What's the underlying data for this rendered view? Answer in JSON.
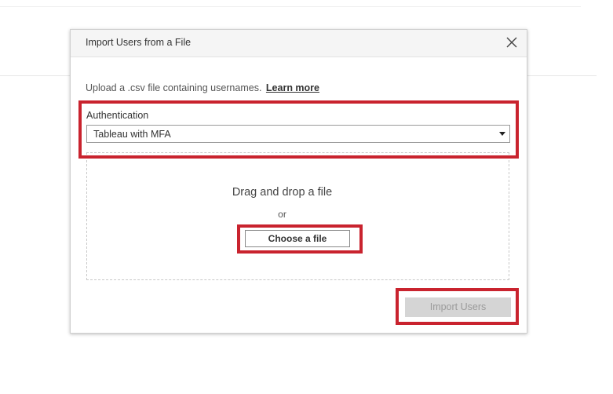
{
  "dialog": {
    "title": "Import Users from a File",
    "intro_text": "Upload a .csv file containing usernames.",
    "learn_more": "Learn more",
    "auth_label": "Authentication",
    "auth_value": "Tableau with MFA",
    "drag_text": "Drag and drop a file",
    "or_text": "or",
    "choose_file": "Choose a file",
    "import_users": "Import Users"
  },
  "highlights": {
    "color": "#c9232e"
  },
  "icons": {
    "close": "close-icon",
    "dropdown": "chevron-down-icon"
  }
}
